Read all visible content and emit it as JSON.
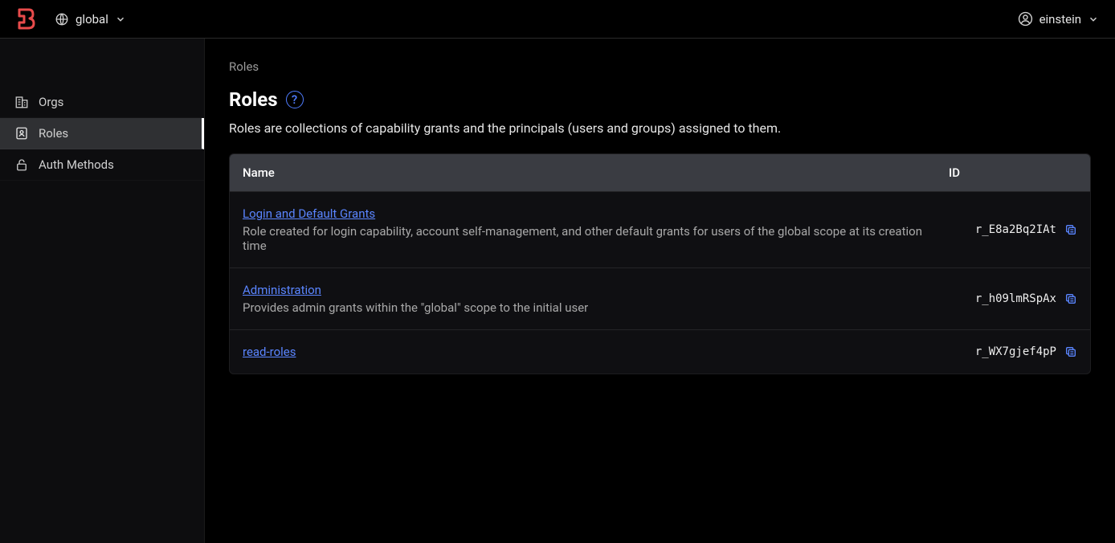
{
  "header": {
    "scope_label": "global",
    "user_label": "einstein"
  },
  "sidebar": {
    "items": [
      {
        "label": "Orgs"
      },
      {
        "label": "Roles"
      },
      {
        "label": "Auth Methods"
      }
    ]
  },
  "breadcrumb": "Roles",
  "page": {
    "title": "Roles",
    "help_glyph": "?",
    "description": "Roles are collections of capability grants and the principals (users and groups) assigned to them."
  },
  "table": {
    "headers": {
      "name": "Name",
      "id": "ID"
    },
    "rows": [
      {
        "name": "Login and Default Grants",
        "description": "Role created for login capability, account self-management, and other default grants for users of the global scope at its creation time",
        "id": "r_E8a2Bq2IAt"
      },
      {
        "name": "Administration",
        "description": "Provides admin grants within the \"global\" scope to the initial user",
        "id": "r_h09lmRSpAx"
      },
      {
        "name": "read-roles",
        "description": "",
        "id": "r_WX7gjef4pP"
      }
    ]
  }
}
